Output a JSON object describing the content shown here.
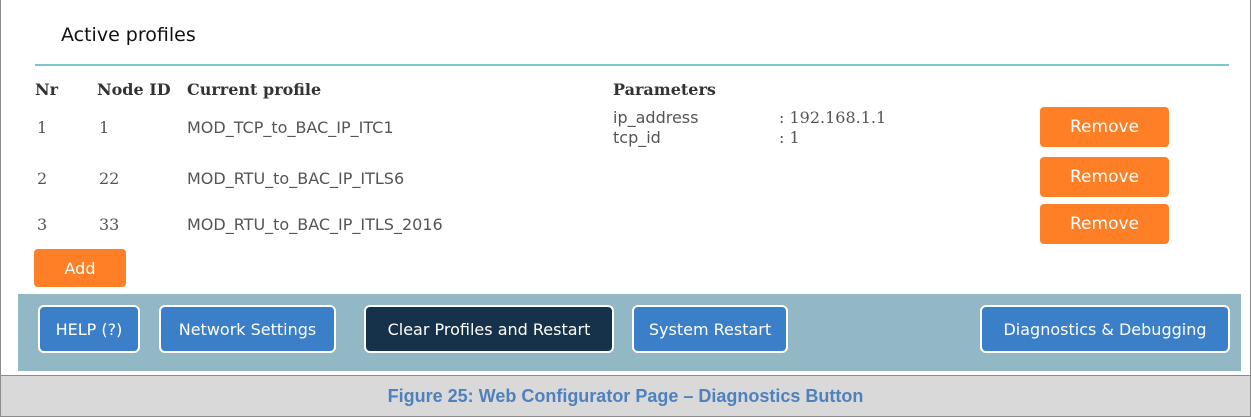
{
  "section": {
    "title": "Active profiles"
  },
  "table": {
    "headers": {
      "nr": "Nr",
      "node_id": "Node ID",
      "current_profile": "Current profile",
      "parameters": "Parameters"
    },
    "rows": [
      {
        "nr": "1",
        "node_id": "1",
        "profile": "MOD_TCP_to_BAC_IP_ITC1",
        "params": [
          {
            "name": "ip_address",
            "value": ": 192.168.1.1"
          },
          {
            "name": "tcp_id",
            "value": ": 1"
          }
        ],
        "action": "Remove"
      },
      {
        "nr": "2",
        "node_id": "22",
        "profile": "MOD_RTU_to_BAC_IP_ITLS6",
        "params": [],
        "action": "Remove"
      },
      {
        "nr": "3",
        "node_id": "33",
        "profile": "MOD_RTU_to_BAC_IP_ITLS_2016",
        "params": [],
        "action": "Remove"
      }
    ]
  },
  "add_label": "Add",
  "toolbar": {
    "help": "HELP (?)",
    "network_settings": "Network Settings",
    "clear_profiles": "Clear Profiles and Restart",
    "system_restart": "System Restart",
    "diagnostics": "Diagnostics & Debugging"
  },
  "caption": "Figure 25: Web Configurator Page – Diagnostics Button",
  "colors": {
    "accent_orange": "#ff7f26",
    "button_blue": "#3a7fc7",
    "button_dark": "#16324a",
    "toolbar_bg": "#92b7c5",
    "rule": "#7ec3d6",
    "caption_text": "#4f81bd"
  }
}
